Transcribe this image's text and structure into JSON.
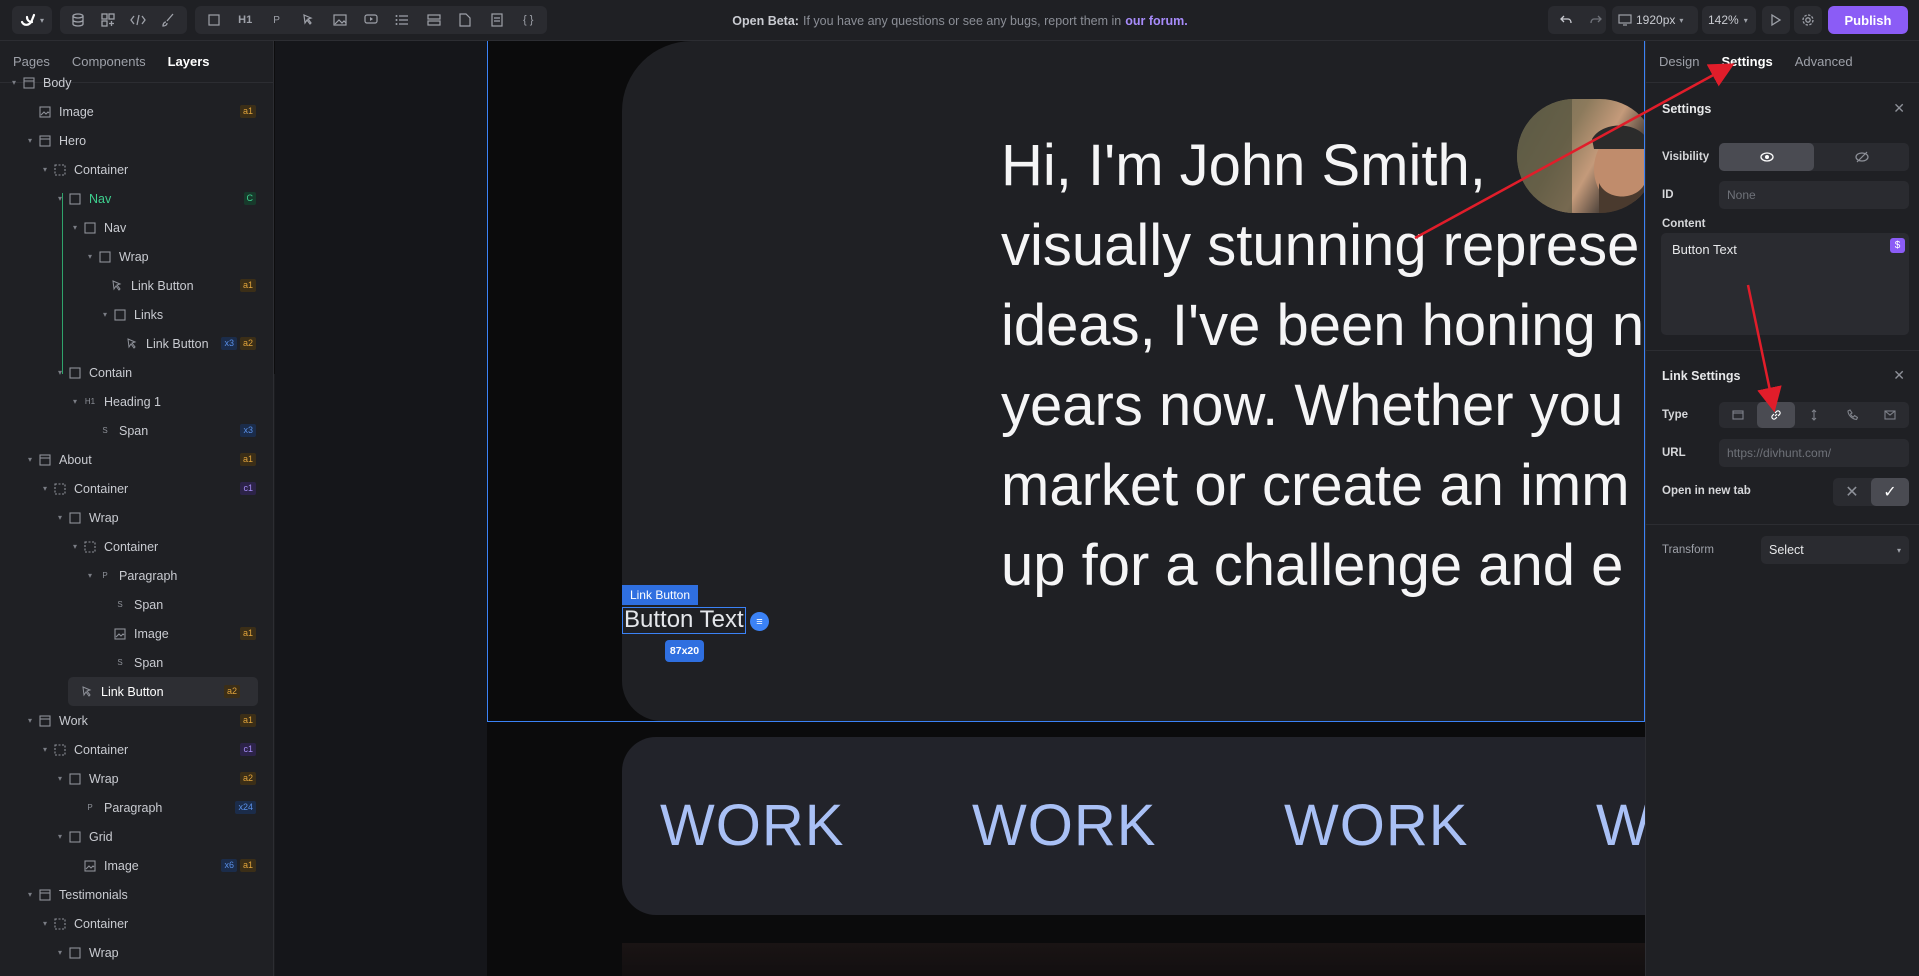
{
  "topbar": {
    "beta_bold": "Open Beta:",
    "beta_text": "If you have any questions or see any bugs, report them in",
    "beta_link": "our forum.",
    "viewport": "1920px",
    "zoom": "142%",
    "publish": "Publish",
    "tool_h1": "H1",
    "tool_p": "P",
    "tool_code": "{ }"
  },
  "left": {
    "tabs": [
      "Pages",
      "Components",
      "Layers"
    ],
    "layers": [
      {
        "label": "Body",
        "icon": "section-icon",
        "badges": []
      },
      {
        "label": "Image",
        "icon": "image-icon",
        "badges": [
          {
            "t": "a1",
            "c": "orange"
          }
        ]
      },
      {
        "label": "Hero",
        "icon": "section-icon",
        "badges": []
      },
      {
        "label": "Container",
        "icon": "container-icon",
        "badges": []
      },
      {
        "label": "Nav",
        "icon": "block-icon",
        "badges": [
          {
            "t": "C",
            "c": "green"
          }
        ]
      },
      {
        "label": "Nav",
        "icon": "block-icon",
        "badges": []
      },
      {
        "label": "Wrap",
        "icon": "block-icon",
        "badges": []
      },
      {
        "label": "Link Button",
        "icon": "link-button-icon",
        "badges": [
          {
            "t": "a1",
            "c": "orange"
          }
        ]
      },
      {
        "label": "Links",
        "icon": "block-icon",
        "badges": []
      },
      {
        "label": "Link Button",
        "icon": "link-button-icon",
        "badges": [
          {
            "t": "x3",
            "c": "blue"
          },
          {
            "t": "a2",
            "c": "orange"
          }
        ]
      },
      {
        "label": "Contain",
        "icon": "block-icon",
        "badges": []
      },
      {
        "label": "Heading 1",
        "icon": "heading-icon",
        "badges": []
      },
      {
        "label": "Span",
        "icon": "span-icon",
        "badges": [
          {
            "t": "x3",
            "c": "blue"
          }
        ]
      },
      {
        "label": "About",
        "icon": "section-icon",
        "badges": [
          {
            "t": "a1",
            "c": "orange"
          }
        ]
      },
      {
        "label": "Container",
        "icon": "container-icon",
        "badges": [
          {
            "t": "c1",
            "c": "purple"
          }
        ]
      },
      {
        "label": "Wrap",
        "icon": "block-icon",
        "badges": []
      },
      {
        "label": "Container",
        "icon": "container-icon",
        "badges": []
      },
      {
        "label": "Paragraph",
        "icon": "paragraph-icon",
        "badges": []
      },
      {
        "label": "Span",
        "icon": "span-icon",
        "badges": []
      },
      {
        "label": "Image",
        "icon": "image-icon",
        "badges": [
          {
            "t": "a1",
            "c": "orange"
          }
        ]
      },
      {
        "label": "Span",
        "icon": "span-icon",
        "badges": []
      },
      {
        "label": "Link Button",
        "icon": "link-button-icon",
        "badges": [
          {
            "t": "a2",
            "c": "orange"
          }
        ]
      },
      {
        "label": "Work",
        "icon": "section-icon",
        "badges": [
          {
            "t": "a1",
            "c": "orange"
          }
        ]
      },
      {
        "label": "Container",
        "icon": "container-icon",
        "badges": [
          {
            "t": "c1",
            "c": "purple"
          }
        ]
      },
      {
        "label": "Wrap",
        "icon": "block-icon",
        "badges": [
          {
            "t": "a2",
            "c": "orange"
          }
        ]
      },
      {
        "label": "Paragraph",
        "icon": "paragraph-icon",
        "badges": [
          {
            "t": "x24",
            "c": "blue"
          }
        ]
      },
      {
        "label": "Grid",
        "icon": "block-icon",
        "badges": []
      },
      {
        "label": "Image",
        "icon": "image-icon",
        "badges": [
          {
            "t": "x6",
            "c": "blue"
          },
          {
            "t": "a1",
            "c": "orange"
          }
        ]
      },
      {
        "label": "Testimonials",
        "icon": "section-icon",
        "badges": []
      },
      {
        "label": "Container",
        "icon": "container-icon",
        "badges": []
      },
      {
        "label": "Wrap",
        "icon": "block-icon",
        "badges": []
      }
    ]
  },
  "canvas": {
    "hero_lines": [
      "Hi, I'm John Smith,",
      "visually stunning represe",
      "ideas, I've been honing n",
      "years now. Whether you",
      "market or create an imm",
      "up for a challenge and e"
    ],
    "tag_label": "Link Button",
    "button_text": "Button Text",
    "dims": "87x20",
    "work_words": [
      "WORK",
      "WORK",
      "WORK",
      "W"
    ]
  },
  "right": {
    "tabs": [
      "Design",
      "Settings",
      "Advanced"
    ],
    "settings_title": "Settings",
    "visibility_label": "Visibility",
    "id_label": "ID",
    "id_placeholder": "None",
    "content_label": "Content",
    "content_value": "Button Text",
    "content_var_icon": "$",
    "link_settings_title": "Link Settings",
    "type_label": "Type",
    "url_label": "URL",
    "url_placeholder": "https://divhunt.com/",
    "newtab_label": "Open in new tab",
    "transform_label": "Transform",
    "transform_value": "Select"
  },
  "colors": {
    "accent": "#8b5cf6",
    "selection": "#3b82f6",
    "annotation_arrow": "#e11d2a"
  }
}
